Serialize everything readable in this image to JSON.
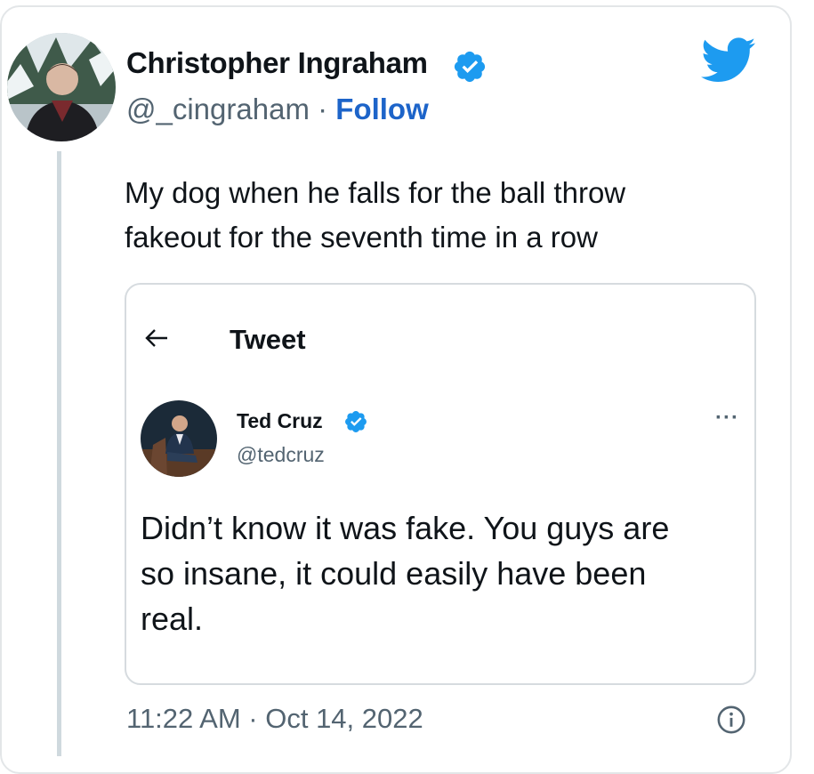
{
  "tweet": {
    "author_name": "Christopher Ingraham",
    "handle": "@_cingraham",
    "separator": "·",
    "follow_label": "Follow",
    "text_lines": [
      "My dog when he falls for the ball throw",
      "fakeout for the seventh time in a row"
    ],
    "timestamp": "11:22 AM · Oct 14, 2022",
    "brand_color": "#1d9bf0"
  },
  "embedded": {
    "header_title": "Tweet",
    "author_name": "Ted Cruz",
    "handle": "@tedcruz",
    "text_lines": [
      "Didn’t know it was fake. You guys are",
      "so insane, it could easily have been",
      "real."
    ]
  },
  "icons": {
    "verified": "verified-badge-icon",
    "twitter": "twitter-bird-icon",
    "back": "back-arrow-icon",
    "more": "more-options-icon",
    "info": "info-icon"
  }
}
